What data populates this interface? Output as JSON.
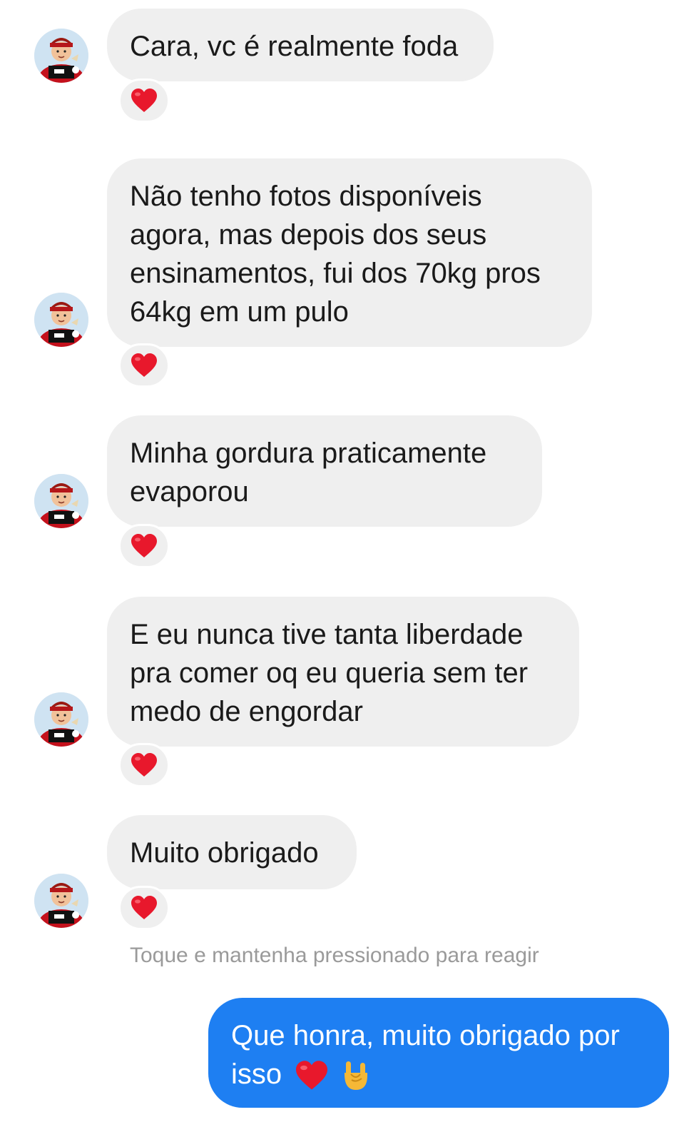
{
  "messages": {
    "incoming": [
      {
        "text": "Cara, vc é realmente foda",
        "reaction": "heart-icon"
      },
      {
        "text": "Não tenho fotos disponíveis\nagora, mas depois dos seus\nensinamentos, fui dos 70kg pros\n64kg em um pulo",
        "reaction": "heart-icon"
      },
      {
        "text": "Minha gordura praticamente\nevaporou",
        "reaction": "heart-icon"
      },
      {
        "text": "E eu nunca tive tanta liberdade\npra comer oq eu queria sem ter\nmedo de engordar",
        "reaction": "heart-icon"
      },
      {
        "text": "Muito obrigado",
        "reaction": "heart-icon"
      }
    ],
    "hint": "Toque e mantenha pressionado para reagir",
    "outgoing": {
      "text_line1": "Que honra, muito obrigado por",
      "text_line2": "isso",
      "emojis": [
        "heart-icon",
        "rock-hand-icon"
      ]
    }
  },
  "colors": {
    "incoming_bubble": "#efefef",
    "outgoing_bubble": "#1e7ff2",
    "reaction_heart": "#e8182c",
    "hint_text": "#9a9a9a"
  }
}
